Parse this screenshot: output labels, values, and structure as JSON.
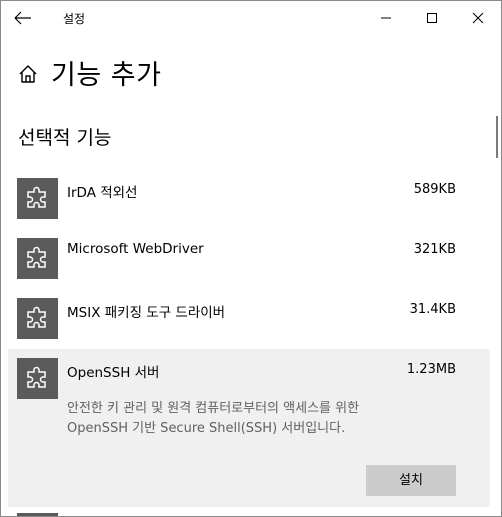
{
  "window": {
    "title": "설정"
  },
  "header": {
    "page_title": "기능 추가",
    "section_title": "선택적 기능"
  },
  "icons": {
    "back": "back-arrow-icon",
    "home": "home-icon",
    "feature": "puzzle-piece-icon",
    "minimize": "minimize-icon",
    "maximize": "maximize-icon",
    "close": "close-icon"
  },
  "features": [
    {
      "name": "IrDA 적외선",
      "size": "589KB"
    },
    {
      "name": "Microsoft WebDriver",
      "size": "321KB"
    },
    {
      "name": "MSIX 패키징 도구 드라이버",
      "size": "31.4KB"
    },
    {
      "name": "OpenSSH 서버",
      "size": "1.23MB",
      "description_line1": "안전한 키 관리 및 원격 컴퓨터로부터의 액세스를 위한",
      "description_line2": "OpenSSH 기반 Secure Shell(SSH) 서버입니다.",
      "install_label": "설치"
    }
  ],
  "colors": {
    "icon_bg": "#5b5b5b",
    "expanded_bg": "#f0f0f0",
    "button_bg": "#cccccc"
  }
}
